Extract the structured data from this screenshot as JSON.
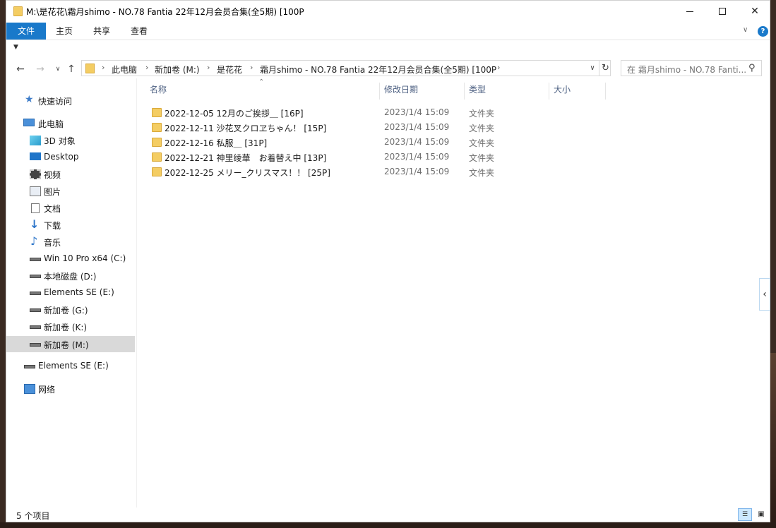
{
  "window": {
    "title": "M:\\是花花\\霜月shimo - NO.78 Fantia 22年12月会员合集(全5期) [100P"
  },
  "ribbon": {
    "tabs": [
      "文件",
      "主页",
      "共享",
      "查看"
    ],
    "help": "?"
  },
  "address": {
    "crumbs": [
      "此电脑",
      "新加卷 (M:)",
      "是花花",
      "霜月shimo - NO.78 Fantia 22年12月会员合集(全5期) [100P"
    ]
  },
  "search": {
    "placeholder": "在 霜月shimo - NO.78 Fanti..."
  },
  "sidebar": {
    "items": [
      {
        "label": "快速访问",
        "icon": "star-icon"
      },
      {
        "label": "此电脑",
        "icon": "computer-icon"
      },
      {
        "label": "3D 对象",
        "icon": "3d-objects-icon"
      },
      {
        "label": "Desktop",
        "icon": "desktop-icon"
      },
      {
        "label": "视频",
        "icon": "video-icon"
      },
      {
        "label": "图片",
        "icon": "pictures-icon"
      },
      {
        "label": "文档",
        "icon": "documents-icon"
      },
      {
        "label": "下载",
        "icon": "download-icon"
      },
      {
        "label": "音乐",
        "icon": "music-icon"
      },
      {
        "label": "Win 10 Pro x64 (C:)",
        "icon": "drive-icon"
      },
      {
        "label": "本地磁盘 (D:)",
        "icon": "drive-icon"
      },
      {
        "label": "Elements SE (E:)",
        "icon": "drive-icon"
      },
      {
        "label": "新加卷 (G:)",
        "icon": "drive-icon"
      },
      {
        "label": "新加卷 (K:)",
        "icon": "drive-icon"
      },
      {
        "label": "新加卷 (M:)",
        "icon": "drive-icon",
        "selected": true
      },
      {
        "label": "Elements SE (E:)",
        "icon": "drive-icon"
      },
      {
        "label": "网络",
        "icon": "network-icon"
      }
    ]
  },
  "columns": {
    "name": "名称",
    "date": "修改日期",
    "type": "类型",
    "size": "大小"
  },
  "files": [
    {
      "name": "2022-12-05 12月のご挨拶＿ [16P]",
      "date": "2023/1/4 15:09",
      "type": "文件夹"
    },
    {
      "name": "2022-12-11 沙花叉クロヱちゃん！ [15P]",
      "date": "2023/1/4 15:09",
      "type": "文件夹"
    },
    {
      "name": "2022-12-16 私服＿ [31P]",
      "date": "2023/1/4 15:09",
      "type": "文件夹"
    },
    {
      "name": "2022-12-21 神里绫華　お着替え中 [13P]",
      "date": "2023/1/4 15:09",
      "type": "文件夹"
    },
    {
      "name": "2022-12-25 メリー_クリスマス！！ [25P]",
      "date": "2023/1/4 15:09",
      "type": "文件夹"
    }
  ],
  "status": {
    "count": "5 个项目"
  }
}
